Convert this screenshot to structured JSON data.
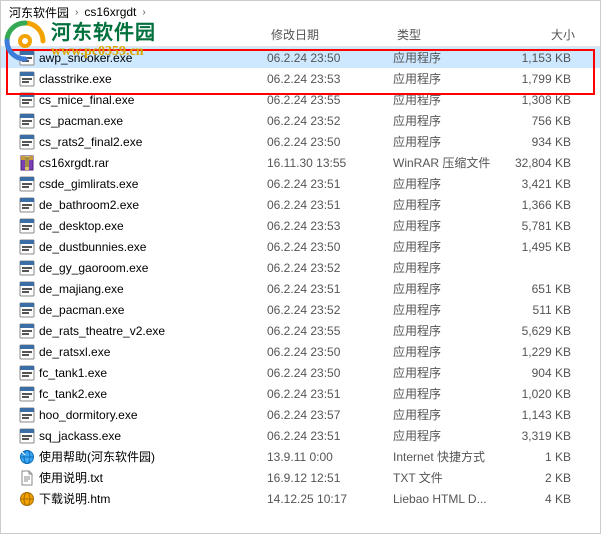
{
  "breadcrumb": {
    "part1": "河东软件园",
    "part2": "cs16xrgdt"
  },
  "watermark": {
    "cn": "河东软件园",
    "url": "www.pc0359.cn"
  },
  "columns": {
    "name": "",
    "date": "修改日期",
    "type": "类型",
    "size": "大小"
  },
  "files": [
    {
      "icon": "exe",
      "name": "awp_snooker.exe",
      "date": "06.2.24 23:50",
      "type": "应用程序",
      "size": "1,153 KB",
      "selected": true
    },
    {
      "icon": "exe",
      "name": "classtrike.exe",
      "date": "06.2.24 23:53",
      "type": "应用程序",
      "size": "1,799 KB"
    },
    {
      "icon": "exe",
      "name": "cs_mice_final.exe",
      "date": "06.2.24 23:55",
      "type": "应用程序",
      "size": "1,308 KB"
    },
    {
      "icon": "exe",
      "name": "cs_pacman.exe",
      "date": "06.2.24 23:52",
      "type": "应用程序",
      "size": "756 KB"
    },
    {
      "icon": "exe",
      "name": "cs_rats2_final2.exe",
      "date": "06.2.24 23:50",
      "type": "应用程序",
      "size": "934 KB"
    },
    {
      "icon": "rar",
      "name": "cs16xrgdt.rar",
      "date": "16.11.30 13:55",
      "type": "WinRAR 压缩文件",
      "size": "32,804 KB"
    },
    {
      "icon": "exe",
      "name": "csde_gimlirats.exe",
      "date": "06.2.24 23:51",
      "type": "应用程序",
      "size": "3,421 KB"
    },
    {
      "icon": "exe",
      "name": "de_bathroom2.exe",
      "date": "06.2.24 23:51",
      "type": "应用程序",
      "size": "1,366 KB"
    },
    {
      "icon": "exe",
      "name": "de_desktop.exe",
      "date": "06.2.24 23:53",
      "type": "应用程序",
      "size": "5,781 KB"
    },
    {
      "icon": "exe",
      "name": "de_dustbunnies.exe",
      "date": "06.2.24 23:50",
      "type": "应用程序",
      "size": "1,495 KB"
    },
    {
      "icon": "exe",
      "name": "de_gy_gaoroom.exe",
      "date": "06.2.24 23:52",
      "type": "应用程序",
      "size": ""
    },
    {
      "icon": "exe",
      "name": "de_majiang.exe",
      "date": "06.2.24 23:51",
      "type": "应用程序",
      "size": "651 KB"
    },
    {
      "icon": "exe",
      "name": "de_pacman.exe",
      "date": "06.2.24 23:52",
      "type": "应用程序",
      "size": "511 KB"
    },
    {
      "icon": "exe",
      "name": "de_rats_theatre_v2.exe",
      "date": "06.2.24 23:55",
      "type": "应用程序",
      "size": "5,629 KB"
    },
    {
      "icon": "exe",
      "name": "de_ratsxl.exe",
      "date": "06.2.24 23:50",
      "type": "应用程序",
      "size": "1,229 KB"
    },
    {
      "icon": "exe",
      "name": "fc_tank1.exe",
      "date": "06.2.24 23:50",
      "type": "应用程序",
      "size": "904 KB"
    },
    {
      "icon": "exe",
      "name": "fc_tank2.exe",
      "date": "06.2.24 23:51",
      "type": "应用程序",
      "size": "1,020 KB"
    },
    {
      "icon": "exe",
      "name": "hoo_dormitory.exe",
      "date": "06.2.24 23:57",
      "type": "应用程序",
      "size": "1,143 KB"
    },
    {
      "icon": "exe",
      "name": "sq_jackass.exe",
      "date": "06.2.24 23:51",
      "type": "应用程序",
      "size": "3,319 KB"
    },
    {
      "icon": "url",
      "name": "使用帮助(河东软件园)",
      "date": "13.9.11 0:00",
      "type": "Internet 快捷方式",
      "size": "1 KB"
    },
    {
      "icon": "txt",
      "name": "使用说明.txt",
      "date": "16.9.12 12:51",
      "type": "TXT 文件",
      "size": "2 KB"
    },
    {
      "icon": "htm",
      "name": "下载说明.htm",
      "date": "14.12.25 10:17",
      "type": "Liebao HTML D...",
      "size": "4 KB"
    }
  ]
}
